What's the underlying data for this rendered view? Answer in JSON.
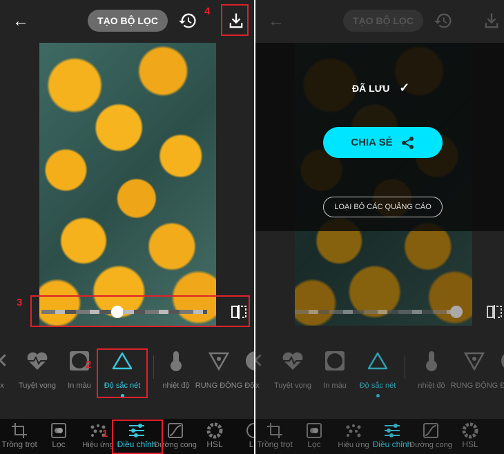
{
  "header": {
    "create_filter_label": "TẠO BỘ LỌC"
  },
  "tools": [
    {
      "label": "ex",
      "icon": "x-icon"
    },
    {
      "label": "Tuyệt vọng",
      "icon": "heartbeat-icon"
    },
    {
      "label": "In màu",
      "icon": "vignette-icon"
    },
    {
      "label": "Độ sắc nét",
      "icon": "triangle-icon",
      "active": true
    },
    {
      "label": "nhiệt độ",
      "icon": "thermometer-icon"
    },
    {
      "label": "RUNG ĐỘNG",
      "icon": "vibrance-icon"
    },
    {
      "label": "Độ lex",
      "icon": "partial-icon"
    }
  ],
  "nav": [
    {
      "label": "Trồng trọt",
      "icon": "crop-icon"
    },
    {
      "label": "Lọc",
      "icon": "filter-icon"
    },
    {
      "label": "Hiệu ứng",
      "icon": "effects-icon"
    },
    {
      "label": "Điều chỉnh",
      "icon": "sliders-icon",
      "active": true
    },
    {
      "label": "Đường cong",
      "icon": "curve-icon"
    },
    {
      "label": "HSL",
      "icon": "hsl-icon"
    },
    {
      "label": "Lớ",
      "icon": "layer-icon"
    }
  ],
  "slider": {
    "left_value_pct": 45,
    "right_value_pct": 100
  },
  "annotations": [
    "1",
    "2",
    "3",
    "4"
  ],
  "saved_dialog": {
    "saved_label": "ĐÃ LƯU",
    "share_label": "CHIA SẺ",
    "remove_ads_label": "LOẠI BỎ CÁC QUẢNG CÁO"
  },
  "colors": {
    "accent": "#35c9e0",
    "share_button": "#00e5ff",
    "annotation": "#e0202a"
  }
}
